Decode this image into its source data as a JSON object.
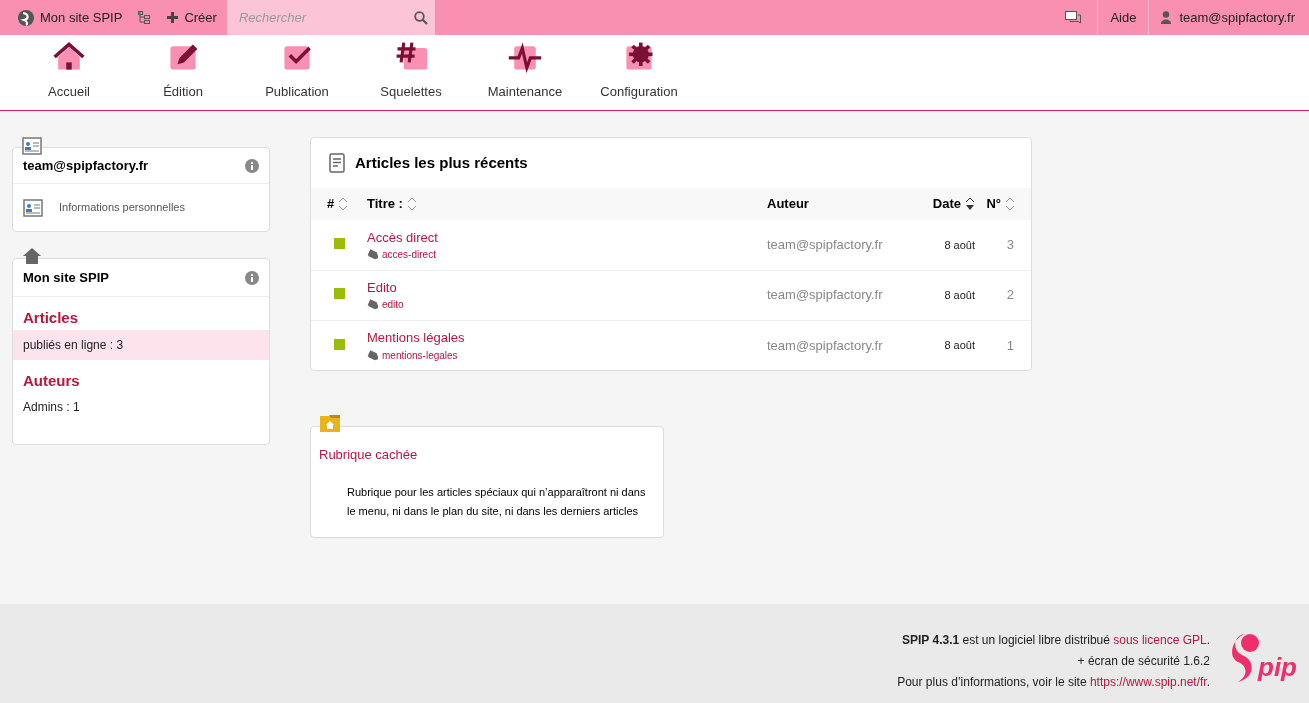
{
  "topbar": {
    "site": "Mon site SPIP",
    "create": "Créer",
    "search": {
      "placeholder": "Rechercher"
    },
    "help": "Aide",
    "user": "team@spipfactory.fr"
  },
  "menu": [
    {
      "label": "Accueil",
      "kind": "home"
    },
    {
      "label": "Édition",
      "kind": "edit"
    },
    {
      "label": "Publication",
      "kind": "publish"
    },
    {
      "label": "Squelettes",
      "kind": "hash"
    },
    {
      "label": "Maintenance",
      "kind": "pulse"
    },
    {
      "label": "Configuration",
      "kind": "gear"
    }
  ],
  "profile_box": {
    "title": "team@spipfactory.fr",
    "link": "Informations personnelles"
  },
  "site_box": {
    "title": "Mon site SPIP",
    "sections": [
      {
        "heading": "Articles",
        "line": "publiés en ligne : 3",
        "highlighted": true
      },
      {
        "heading": "Auteurs",
        "line": "Admins : 1",
        "highlighted": false
      }
    ]
  },
  "articles": {
    "title": "Articles les plus récents",
    "columns": [
      {
        "label": "#",
        "kind": "sortable"
      },
      {
        "label": "Titre :",
        "kind": "sortable"
      },
      {
        "label": "Auteur",
        "kind": "plain"
      },
      {
        "label": "Date",
        "kind": "sorted"
      },
      {
        "label": "N°",
        "kind": "sortable"
      }
    ],
    "rows": [
      {
        "color": "#9cbc0a",
        "title": "Accès direct",
        "slug": "acces-direct",
        "author": "team@spipfactory.fr",
        "date": "8 août",
        "number": "3"
      },
      {
        "color": "#9cbc0a",
        "title": "Edito",
        "slug": "edito",
        "author": "team@spipfactory.fr",
        "date": "8 août",
        "number": "2"
      },
      {
        "color": "#9cbc0a",
        "title": "Mentions légales",
        "slug": "mentions-legales",
        "author": "team@spipfactory.fr",
        "date": "8 août",
        "number": "1"
      }
    ]
  },
  "rubrique": {
    "title": "Rubrique cachée",
    "description": "Rubrique pour les articles spéciaux qui n’apparaîtront ni dans le menu, ni dans le plan du site, ni dans les derniers articles"
  },
  "footer": {
    "line1": {
      "text": "**SPIP 4.3.1** est un logiciel libre distribué ",
      "link": "sous licence GPL",
      "tail": "."
    },
    "line2": "+ écran de sécurité 1.6.2",
    "line3": {
      "text": "Pour plus d’informations, voir le site ",
      "link": "https://www.spip.net/fr",
      "tail": "."
    },
    "logo_text": "pip"
  }
}
